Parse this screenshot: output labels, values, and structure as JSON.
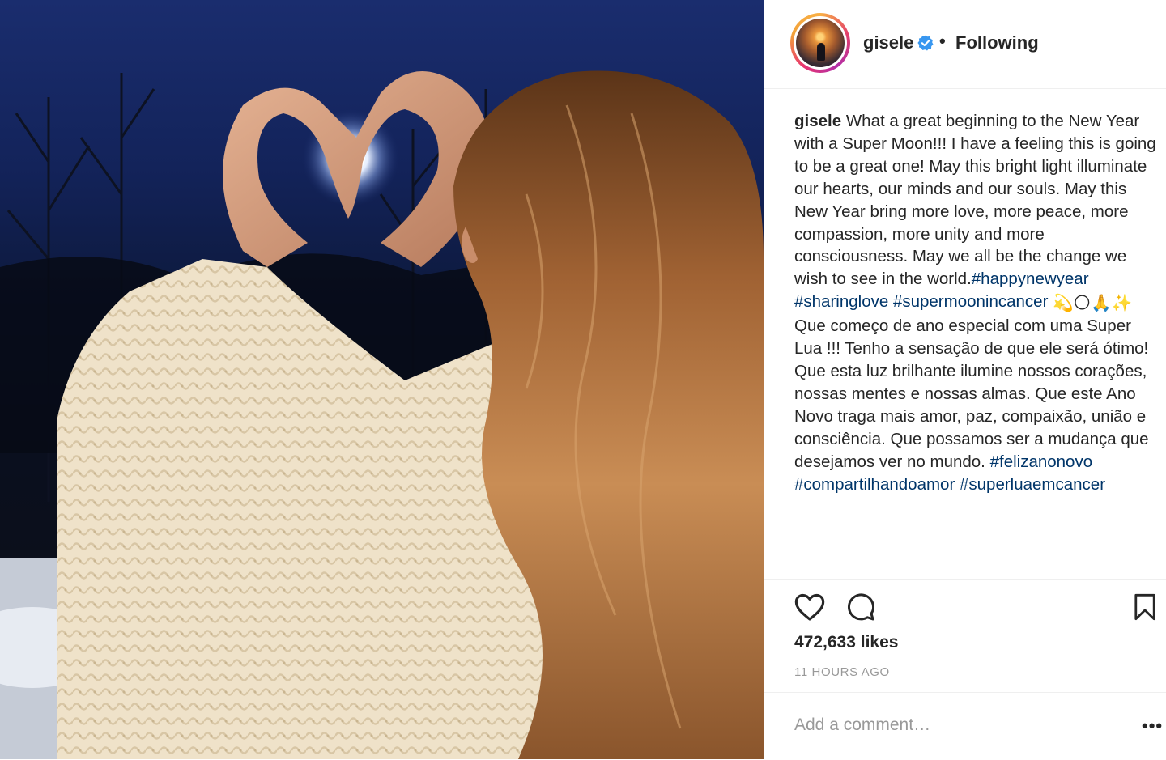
{
  "post": {
    "image_alt": "Woman in a cream knit sweater making a heart shape with her hands around the full moon",
    "author": {
      "username": "gisele",
      "verified": true,
      "separator": "•",
      "follow_status": "Following"
    },
    "caption": {
      "username": "gisele",
      "text_1": " What a great beginning to the New Year with a Super Moon!!! I have a feeling this is going to be a great one! May this bright light illuminate our hearts, our minds and our souls. May this New Year bring more love, more peace, more compassion, more unity and more consciousness. May we all be the change we wish to see in the world.",
      "tags_1": [
        "#happynewyear",
        "#sharinglove",
        "#supermoonincancer"
      ],
      "emojis": "💫🌕🙏✨",
      "text_2": "Que começo de ano especial com uma Super Lua !!! Tenho a sensação de que ele será ótimo! Que esta luz brilhante ilumine nossos corações, nossas mentes e nossas almas. Que este Ano Novo traga mais amor, paz, compaixão, união e consciência. Que possamos ser a mudança que desejamos ver no mundo.",
      "tags_2": [
        "#felizanonovo",
        "#compartilhandoamor",
        "#superluaemcancer"
      ]
    },
    "actions": {
      "like_icon": "heart-icon",
      "comment_icon": "comment-bubble-icon",
      "save_icon": "bookmark-icon"
    },
    "likes": "472,633 likes",
    "timestamp": "11 HOURS AGO",
    "comment": {
      "placeholder": "Add a comment…",
      "value": "",
      "more_label": "•••"
    }
  },
  "colors": {
    "hashtag": "#003569",
    "text": "#262626",
    "muted": "#999999",
    "verified": "#3897f0"
  }
}
